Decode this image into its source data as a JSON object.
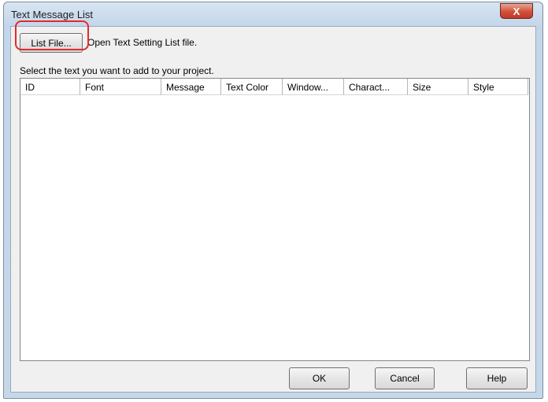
{
  "window": {
    "title": "Text Message List",
    "close_glyph": "X"
  },
  "toolbar": {
    "list_file_label": "List File...",
    "list_file_hint": "Open Text Setting List file."
  },
  "prompt": "Select the text you want to add to your project.",
  "table": {
    "columns": [
      "ID",
      "Font",
      "Message",
      "Text Color",
      "Window...",
      "Charact...",
      "Size",
      "Style"
    ],
    "rows": []
  },
  "footer": {
    "ok_label": "OK",
    "cancel_label": "Cancel",
    "help_label": "Help"
  },
  "colors": {
    "highlight": "#e32b2b",
    "close_button": "#c0392b"
  }
}
